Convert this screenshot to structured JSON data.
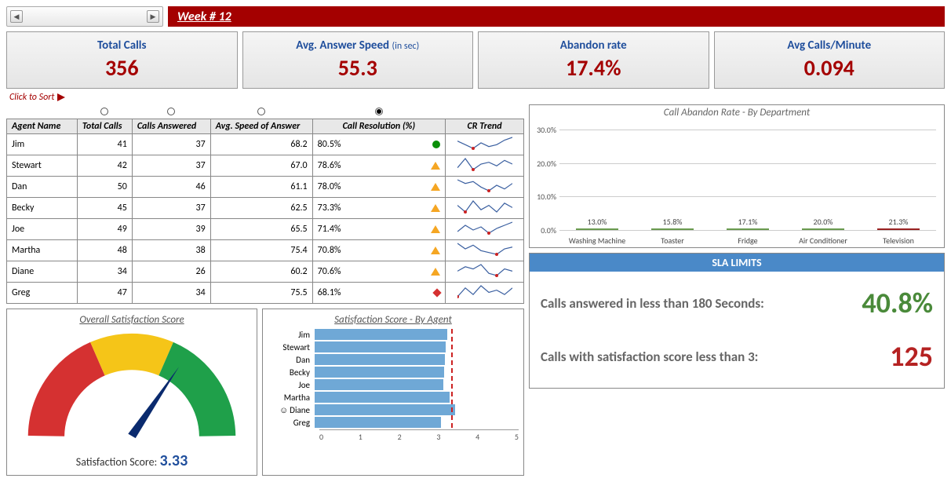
{
  "header": {
    "week_label": "Week # 12"
  },
  "kpi": [
    {
      "title": "Total Calls",
      "sub": "",
      "value": "356"
    },
    {
      "title": "Avg. Answer Speed",
      "sub": "(in sec)",
      "value": "55.3"
    },
    {
      "title": "Abandon rate",
      "sub": "",
      "value": "17.4%"
    },
    {
      "title": "Avg Calls/Minute",
      "sub": "",
      "value": "0.094"
    }
  ],
  "sort_hint": "Click to Sort",
  "table": {
    "headers": [
      "Agent Name",
      "Total Calls",
      "Calls Answered",
      "Avg. Speed of Answer",
      "Call Resolution (%)",
      "CR Trend"
    ],
    "sort_selected_index": 4,
    "rows": [
      {
        "agent": "Jim",
        "calls": 41,
        "answered": 37,
        "speed": "68.2",
        "cr": "80.5%",
        "indicator": "green",
        "spark": [
          14,
          10,
          6,
          12,
          8,
          10,
          15,
          18
        ]
      },
      {
        "agent": "Stewart",
        "calls": 42,
        "answered": 37,
        "speed": "67.0",
        "cr": "78.6%",
        "indicator": "orange",
        "spark": [
          6,
          16,
          4,
          10,
          12,
          8,
          14,
          10
        ]
      },
      {
        "agent": "Dan",
        "calls": 50,
        "answered": 46,
        "speed": "61.1",
        "cr": "78.0%",
        "indicator": "orange",
        "spark": [
          16,
          12,
          14,
          8,
          4,
          10,
          6,
          12
        ]
      },
      {
        "agent": "Becky",
        "calls": 45,
        "answered": 37,
        "speed": "62.5",
        "cr": "73.3%",
        "indicator": "orange",
        "spark": [
          12,
          6,
          16,
          8,
          12,
          6,
          14,
          10
        ]
      },
      {
        "agent": "Joe",
        "calls": 49,
        "answered": 39,
        "speed": "65.5",
        "cr": "71.4%",
        "indicator": "orange",
        "spark": [
          6,
          14,
          8,
          12,
          4,
          10,
          14,
          18
        ]
      },
      {
        "agent": "Martha",
        "calls": 48,
        "answered": 38,
        "speed": "75.4",
        "cr": "70.8%",
        "indicator": "orange",
        "spark": [
          16,
          10,
          14,
          8,
          6,
          4,
          10,
          12
        ]
      },
      {
        "agent": "Diane",
        "calls": 34,
        "answered": 26,
        "speed": "60.2",
        "cr": "70.6%",
        "indicator": "orange",
        "spark": [
          8,
          12,
          10,
          14,
          6,
          4,
          10,
          8
        ]
      },
      {
        "agent": "Greg",
        "calls": 47,
        "answered": 34,
        "speed": "75.5",
        "cr": "68.1%",
        "indicator": "red",
        "spark": [
          4,
          12,
          6,
          14,
          8,
          10,
          6,
          12
        ]
      }
    ]
  },
  "satisfaction": {
    "panel_title": "Overall Satisfaction Score",
    "score_label": "Satisfaction Score:",
    "score_value": "3.33",
    "gauge_value": 3.33,
    "gauge_max": 5
  },
  "agent_sat": {
    "panel_title": "Satisfaction Score - By Agent",
    "max": 5,
    "target": 3.3,
    "best_agent": "Diane",
    "rows": [
      {
        "agent": "Jim",
        "score": 3.25
      },
      {
        "agent": "Stewart",
        "score": 3.22
      },
      {
        "agent": "Dan",
        "score": 3.2
      },
      {
        "agent": "Becky",
        "score": 3.18
      },
      {
        "agent": "Joe",
        "score": 3.15
      },
      {
        "agent": "Martha",
        "score": 3.3
      },
      {
        "agent": "Diane",
        "score": 3.45
      },
      {
        "agent": "Greg",
        "score": 3.1
      }
    ],
    "axis_ticks": [
      "0",
      "1",
      "2",
      "3",
      "4",
      "5"
    ]
  },
  "abandon": {
    "title": "Call Abandon Rate - By Department",
    "ymax": 30,
    "yticks": [
      "0.0%",
      "10.0%",
      "20.0%",
      "30.0%"
    ]
  },
  "chart_data": {
    "type": "bar",
    "title": "Call Abandon Rate - By Department",
    "categories": [
      "Washing Machine",
      "Toaster",
      "Fridge",
      "Air Conditioner",
      "Television"
    ],
    "values": [
      13.0,
      15.8,
      17.1,
      20.0,
      21.3
    ],
    "highlight_index": 4,
    "ylabel": "",
    "xlabel": "",
    "ylim": [
      0,
      30
    ]
  },
  "sla": {
    "header": "SLA LIMITS",
    "row1_label": "Calls answered in less than 180 Seconds:",
    "row1_value": "40.8%",
    "row2_label": "Calls with satisfaction score less than 3:",
    "row2_value": "125"
  }
}
